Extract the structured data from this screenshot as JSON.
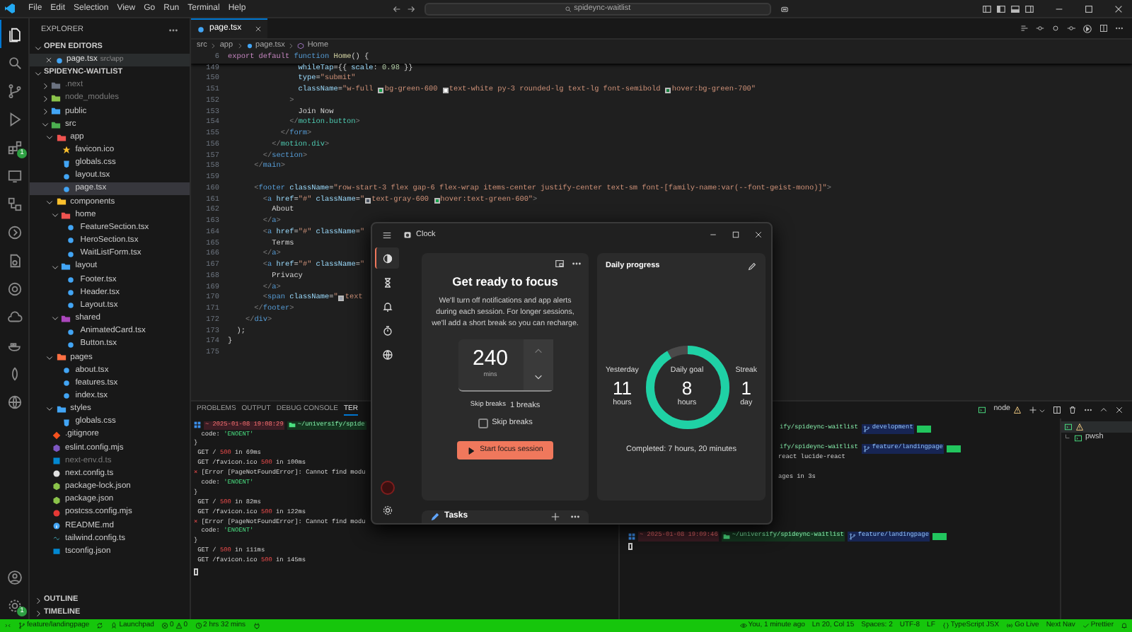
{
  "title_bar": {
    "menu": [
      "File",
      "Edit",
      "Selection",
      "View",
      "Go",
      "Run",
      "Terminal",
      "Help"
    ],
    "search": "spideync-waitlist"
  },
  "activity_bar": {
    "items": [
      {
        "kind": "files",
        "selected": true
      },
      {
        "kind": "search",
        "selected": false
      },
      {
        "kind": "branch",
        "selected": false
      },
      {
        "kind": "run",
        "selected": false
      },
      {
        "kind": "extensions",
        "selected": false,
        "badge": "1"
      },
      {
        "kind": "remote",
        "selected": false
      },
      {
        "kind": "nodes",
        "selected": false
      },
      {
        "kind": "circle",
        "selected": false
      },
      {
        "kind": "doc",
        "selected": false
      },
      {
        "kind": "ring",
        "selected": false
      },
      {
        "kind": "cloud",
        "selected": false
      },
      {
        "kind": "container",
        "selected": false
      },
      {
        "kind": "leaf",
        "selected": false
      },
      {
        "kind": "globe",
        "selected": false
      }
    ],
    "bottom": [
      {
        "kind": "account"
      },
      {
        "kind": "settings",
        "badge": "1"
      }
    ]
  },
  "sidebar": {
    "title": "EXPLORER",
    "open_editors": {
      "label": "OPEN EDITORS",
      "expanded": true,
      "items": [
        {
          "name": "page.tsx",
          "path": "src\\app",
          "kind": "react"
        }
      ]
    },
    "project": {
      "label": "SPIDEYNC-WAITLIST",
      "expanded": true,
      "tree": [
        {
          "label": ".next",
          "kind": "folder",
          "color": "#6b7280",
          "expanded": false,
          "selected": false,
          "dimmed": true
        },
        {
          "label": "node_modules",
          "kind": "folder",
          "color": "#8bc34a",
          "expanded": false,
          "selected": false,
          "dimmed": true
        },
        {
          "label": "public",
          "kind": "folder",
          "color": "#42a5f5",
          "expanded": false,
          "selected": false,
          "dimmed": false
        },
        {
          "label": "src",
          "kind": "folder",
          "color": "#4caf50",
          "expanded": true,
          "selected": false,
          "dimmed": false,
          "children": [
            {
              "label": "app",
              "kind": "folder",
              "color": "#ef5350",
              "expanded": true,
              "selected": false,
              "dimmed": false,
              "children": [
                {
                  "label": "favicon.ico",
                  "kind": "star",
                  "selected": false,
                  "dimmed": false
                },
                {
                  "label": "globals.css",
                  "kind": "css",
                  "selected": false,
                  "dimmed": false
                },
                {
                  "label": "layout.tsx",
                  "kind": "react",
                  "selected": false,
                  "dimmed": false
                },
                {
                  "label": "page.tsx",
                  "kind": "react",
                  "selected": true,
                  "dimmed": false
                }
              ]
            },
            {
              "label": "components",
              "kind": "folder",
              "color": "#fbc02d",
              "expanded": true,
              "selected": false,
              "dimmed": false,
              "children": [
                {
                  "label": "home",
                  "kind": "folder",
                  "color": "#ef5350",
                  "expanded": true,
                  "selected": false,
                  "dimmed": false,
                  "children": [
                    {
                      "label": "FeatureSection.tsx",
                      "kind": "react",
                      "selected": false,
                      "dimmed": false
                    },
                    {
                      "label": "HeroSection.tsx",
                      "kind": "react",
                      "selected": false,
                      "dimmed": false
                    },
                    {
                      "label": "WaitListForm.tsx",
                      "kind": "react",
                      "selected": false,
                      "dimmed": false
                    }
                  ]
                },
                {
                  "label": "layout",
                  "kind": "folder",
                  "color": "#42a5f5",
                  "expanded": true,
                  "selected": false,
                  "dimmed": false,
                  "children": [
                    {
                      "label": "Footer.tsx",
                      "kind": "react",
                      "selected": false,
                      "dimmed": false
                    },
                    {
                      "label": "Header.tsx",
                      "kind": "react",
                      "selected": false,
                      "dimmed": false
                    },
                    {
                      "label": "Layout.tsx",
                      "kind": "react",
                      "selected": false,
                      "dimmed": false
                    }
                  ]
                },
                {
                  "label": "shared",
                  "kind": "folder",
                  "color": "#ab47bc",
                  "expanded": true,
                  "selected": false,
                  "dimmed": false,
                  "children": [
                    {
                      "label": "AnimatedCard.tsx",
                      "kind": "react",
                      "selected": false,
                      "dimmed": false
                    },
                    {
                      "label": "Button.tsx",
                      "kind": "react",
                      "selected": false,
                      "dimmed": false
                    }
                  ]
                }
              ]
            },
            {
              "label": "pages",
              "kind": "folder",
              "color": "#ff7043",
              "expanded": true,
              "selected": false,
              "dimmed": false,
              "children": [
                {
                  "label": "about.tsx",
                  "kind": "react",
                  "selected": false,
                  "dimmed": false
                },
                {
                  "label": "features.tsx",
                  "kind": "react",
                  "selected": false,
                  "dimmed": false
                },
                {
                  "label": "index.tsx",
                  "kind": "react",
                  "selected": false,
                  "dimmed": false
                }
              ]
            },
            {
              "label": "styles",
              "kind": "folder",
              "color": "#42a5f5",
              "expanded": true,
              "selected": false,
              "dimmed": false,
              "children": [
                {
                  "label": "globals.css",
                  "kind": "css",
                  "selected": false,
                  "dimmed": false
                }
              ]
            }
          ]
        },
        {
          "label": ".gitignore",
          "kind": "git",
          "selected": false,
          "dimmed": false
        },
        {
          "label": "eslint.config.mjs",
          "kind": "eslint",
          "selected": false,
          "dimmed": false
        },
        {
          "label": "next-env.d.ts",
          "kind": "ts",
          "selected": false,
          "dimmed": true
        },
        {
          "label": "next.config.ts",
          "kind": "next",
          "selected": false,
          "dimmed": false
        },
        {
          "label": "package-lock.json",
          "kind": "npm",
          "selected": false,
          "dimmed": false
        },
        {
          "label": "package.json",
          "kind": "npm",
          "selected": false,
          "dimmed": false
        },
        {
          "label": "postcss.config.mjs",
          "kind": "postcss",
          "selected": false,
          "dimmed": false
        },
        {
          "label": "README.md",
          "kind": "info",
          "selected": false,
          "dimmed": false
        },
        {
          "label": "tailwind.config.ts",
          "kind": "tailwind",
          "selected": false,
          "dimmed": false
        },
        {
          "label": "tsconfig.json",
          "kind": "tsconfig",
          "selected": false,
          "dimmed": false
        }
      ]
    },
    "outline": {
      "label": "OUTLINE",
      "expanded": false
    },
    "timeline": {
      "label": "TIMELINE",
      "expanded": false
    }
  },
  "editor": {
    "tab": {
      "label": "page.tsx",
      "selected": true
    },
    "breadcrumb": [
      "src",
      "app",
      "page.tsx",
      "Home"
    ],
    "sticky_line": {
      "number": "6",
      "segments": [
        {
          "kind": "kw",
          "text": "export default "
        },
        {
          "kind": "decl",
          "text": "function "
        },
        {
          "kind": "fn",
          "text": "Home"
        },
        {
          "kind": "plain",
          "text": "() {"
        }
      ]
    },
    "lines": [
      {
        "number": "149",
        "segments": [
          {
            "kind": "attr",
            "text": "                whileTap"
          },
          {
            "kind": "plain",
            "text": "={{ "
          },
          {
            "kind": "attr",
            "text": "scale"
          },
          {
            "kind": "plain",
            "text": ": "
          },
          {
            "kind": "num",
            "text": "0.98"
          },
          {
            "kind": "plain",
            "text": " }}"
          }
        ]
      },
      {
        "number": "150",
        "segments": [
          {
            "kind": "attr",
            "text": "                type"
          },
          {
            "kind": "plain",
            "text": "="
          },
          {
            "kind": "str",
            "text": "\"submit\""
          }
        ]
      },
      {
        "number": "151",
        "segments": [
          {
            "kind": "attr",
            "text": "                className"
          },
          {
            "kind": "plain",
            "text": "="
          },
          {
            "kind": "str",
            "text": "\"w-full "
          },
          {
            "kind": "swatch",
            "color": "#16a34a"
          },
          {
            "kind": "str",
            "text": "bg-green-600 "
          },
          {
            "kind": "swatch",
            "color": "#ffffff"
          },
          {
            "kind": "str",
            "text": "text-white py-3 rounded-lg text-lg font-semibold "
          },
          {
            "kind": "swatch",
            "color": "#15803d"
          },
          {
            "kind": "str",
            "text": "hover:bg-green-700\""
          }
        ]
      },
      {
        "number": "152",
        "segments": [
          {
            "kind": "punct",
            "text": "              >"
          }
        ]
      },
      {
        "number": "153",
        "segments": [
          {
            "kind": "plain",
            "text": "                Join Now"
          }
        ]
      },
      {
        "number": "154",
        "segments": [
          {
            "kind": "punct",
            "text": "              </"
          },
          {
            "kind": "comp",
            "text": "motion.button"
          },
          {
            "kind": "punct",
            "text": ">"
          }
        ]
      },
      {
        "number": "155",
        "segments": [
          {
            "kind": "punct",
            "text": "            </"
          },
          {
            "kind": "tag",
            "text": "form"
          },
          {
            "kind": "punct",
            "text": ">"
          }
        ]
      },
      {
        "number": "156",
        "segments": [
          {
            "kind": "punct",
            "text": "          </"
          },
          {
            "kind": "comp",
            "text": "motion.div"
          },
          {
            "kind": "punct",
            "text": ">"
          }
        ]
      },
      {
        "number": "157",
        "segments": [
          {
            "kind": "punct",
            "text": "        </"
          },
          {
            "kind": "tag",
            "text": "section"
          },
          {
            "kind": "punct",
            "text": ">"
          }
        ]
      },
      {
        "number": "158",
        "segments": [
          {
            "kind": "punct",
            "text": "      </"
          },
          {
            "kind": "tag",
            "text": "main"
          },
          {
            "kind": "punct",
            "text": ">"
          }
        ]
      },
      {
        "number": "159"
      },
      {
        "number": "160",
        "segments": [
          {
            "kind": "punct",
            "text": "      <"
          },
          {
            "kind": "tag",
            "text": "footer "
          },
          {
            "kind": "attr",
            "text": "className"
          },
          {
            "kind": "plain",
            "text": "="
          },
          {
            "kind": "str",
            "text": "\"row-start-3 flex gap-6 flex-wrap items-center justify-center text-sm font-[family-name:var(--font-geist-mono)]\""
          },
          {
            "kind": "punct",
            "text": ">"
          }
        ]
      },
      {
        "number": "161",
        "segments": [
          {
            "kind": "punct",
            "text": "        <"
          },
          {
            "kind": "tag",
            "text": "a "
          },
          {
            "kind": "attr",
            "text": "href"
          },
          {
            "kind": "plain",
            "text": "="
          },
          {
            "kind": "str",
            "text": "\"#\" "
          },
          {
            "kind": "attr",
            "text": "className"
          },
          {
            "kind": "plain",
            "text": "="
          },
          {
            "kind": "str",
            "text": "\""
          },
          {
            "kind": "swatch",
            "color": "#4b5563"
          },
          {
            "kind": "str",
            "text": "text-gray-600 "
          },
          {
            "kind": "swatch",
            "color": "#16a34a"
          },
          {
            "kind": "str",
            "text": "hover:text-green-600\""
          },
          {
            "kind": "punct",
            "text": ">"
          }
        ]
      },
      {
        "number": "162",
        "segments": [
          {
            "kind": "plain",
            "text": "          About"
          }
        ]
      },
      {
        "number": "163",
        "segments": [
          {
            "kind": "punct",
            "text": "        </"
          },
          {
            "kind": "tag",
            "text": "a"
          },
          {
            "kind": "punct",
            "text": ">"
          }
        ]
      },
      {
        "number": "164",
        "segments": [
          {
            "kind": "punct",
            "text": "        <"
          },
          {
            "kind": "tag",
            "text": "a "
          },
          {
            "kind": "attr",
            "text": "href"
          },
          {
            "kind": "plain",
            "text": "="
          },
          {
            "kind": "str",
            "text": "\"#\" "
          },
          {
            "kind": "attr",
            "text": "className"
          },
          {
            "kind": "plain",
            "text": "="
          },
          {
            "kind": "str",
            "text": "\""
          }
        ]
      },
      {
        "number": "165",
        "segments": [
          {
            "kind": "plain",
            "text": "          Terms"
          }
        ]
      },
      {
        "number": "166",
        "segments": [
          {
            "kind": "punct",
            "text": "        </"
          },
          {
            "kind": "tag",
            "text": "a"
          },
          {
            "kind": "punct",
            "text": ">"
          }
        ]
      },
      {
        "number": "167",
        "segments": [
          {
            "kind": "punct",
            "text": "        <"
          },
          {
            "kind": "tag",
            "text": "a "
          },
          {
            "kind": "attr",
            "text": "href"
          },
          {
            "kind": "plain",
            "text": "="
          },
          {
            "kind": "str",
            "text": "\"#\" "
          },
          {
            "kind": "attr",
            "text": "className"
          },
          {
            "kind": "plain",
            "text": "="
          },
          {
            "kind": "str",
            "text": "\""
          }
        ]
      },
      {
        "number": "168",
        "segments": [
          {
            "kind": "plain",
            "text": "          Privacy"
          }
        ]
      },
      {
        "number": "169",
        "segments": [
          {
            "kind": "punct",
            "text": "        </"
          },
          {
            "kind": "tag",
            "text": "a"
          },
          {
            "kind": "punct",
            "text": ">"
          }
        ]
      },
      {
        "number": "170",
        "segments": [
          {
            "kind": "punct",
            "text": "        <"
          },
          {
            "kind": "tag",
            "text": "span "
          },
          {
            "kind": "attr",
            "text": "className"
          },
          {
            "kind": "plain",
            "text": "="
          },
          {
            "kind": "str",
            "text": "\""
          },
          {
            "kind": "swatch",
            "color": "#9ca3af"
          },
          {
            "kind": "str",
            "text": "text"
          }
        ]
      },
      {
        "number": "171",
        "segments": [
          {
            "kind": "punct",
            "text": "      </"
          },
          {
            "kind": "tag",
            "text": "footer"
          },
          {
            "kind": "punct",
            "text": ">"
          }
        ]
      },
      {
        "number": "172",
        "segments": [
          {
            "kind": "punct",
            "text": "    </"
          },
          {
            "kind": "tag",
            "text": "div"
          },
          {
            "kind": "punct",
            "text": ">"
          }
        ]
      },
      {
        "number": "173",
        "segments": [
          {
            "kind": "plain",
            "text": "  );"
          }
        ]
      },
      {
        "number": "174",
        "segments": [
          {
            "kind": "plain",
            "text": "}"
          }
        ]
      },
      {
        "number": "175"
      }
    ]
  },
  "panel": {
    "tabs": [
      {
        "label": "PROBLEMS",
        "selected": false
      },
      {
        "label": "OUTPUT",
        "selected": false
      },
      {
        "label": "DEBUG CONSOLE",
        "selected": false
      },
      {
        "label": "TER",
        "selected": true
      }
    ],
    "active_terminal": "node",
    "terminal_left": [
      {
        "kind": "prompt",
        "time": "~ 2025-01-08 19:08:29",
        "path": "~/universify/spide"
      },
      {
        "kind": "text",
        "segments": [
          {
            "kind": "plain",
            "text": "  code: "
          },
          {
            "kind": "green",
            "text": "'ENOENT'"
          }
        ]
      },
      {
        "kind": "text",
        "segments": [
          {
            "kind": "plain",
            "text": "}"
          }
        ]
      },
      {
        "kind": "text",
        "segments": [
          {
            "kind": "plain",
            "text": " GET / "
          },
          {
            "kind": "red",
            "text": "500"
          },
          {
            "kind": "plain",
            "text": " in 69ms"
          }
        ]
      },
      {
        "kind": "text",
        "segments": [
          {
            "kind": "plain",
            "text": " GET /favicon.ico "
          },
          {
            "kind": "red",
            "text": "500"
          },
          {
            "kind": "plain",
            "text": " in 100ms"
          }
        ]
      },
      {
        "kind": "text",
        "segments": [
          {
            "kind": "red",
            "text": "⨯"
          },
          {
            "kind": "plain",
            "text": " [Error [PageNotFoundError]: Cannot find modu"
          }
        ]
      },
      {
        "kind": "text",
        "segments": [
          {
            "kind": "plain",
            "text": "  code: "
          },
          {
            "kind": "green",
            "text": "'ENOENT'"
          }
        ]
      },
      {
        "kind": "text",
        "segments": [
          {
            "kind": "plain",
            "text": "}"
          }
        ]
      },
      {
        "kind": "text",
        "segments": [
          {
            "kind": "plain",
            "text": " GET / "
          },
          {
            "kind": "red",
            "text": "500"
          },
          {
            "kind": "plain",
            "text": " in 82ms"
          }
        ]
      },
      {
        "kind": "text",
        "segments": [
          {
            "kind": "plain",
            "text": " GET /favicon.ico "
          },
          {
            "kind": "red",
            "text": "500"
          },
          {
            "kind": "plain",
            "text": " in 122ms"
          }
        ]
      },
      {
        "kind": "text",
        "segments": [
          {
            "kind": "red",
            "text": "⨯"
          },
          {
            "kind": "plain",
            "text": " [Error [PageNotFoundError]: Cannot find modu"
          }
        ]
      },
      {
        "kind": "text",
        "segments": [
          {
            "kind": "plain",
            "text": "  code: "
          },
          {
            "kind": "green",
            "text": "'ENOENT'"
          }
        ]
      },
      {
        "kind": "text",
        "segments": [
          {
            "kind": "plain",
            "text": "}"
          }
        ]
      },
      {
        "kind": "text",
        "segments": [
          {
            "kind": "plain",
            "text": " GET / "
          },
          {
            "kind": "red",
            "text": "500"
          },
          {
            "kind": "plain",
            "text": " in 111ms"
          }
        ]
      },
      {
        "kind": "text",
        "segments": [
          {
            "kind": "plain",
            "text": " GET /favicon.ico "
          },
          {
            "kind": "red",
            "text": "500"
          },
          {
            "kind": "plain",
            "text": " in 145ms"
          }
        ]
      },
      {
        "kind": "cursor"
      }
    ],
    "terminal_right": [
      {
        "kind": "prompt_cut",
        "path": "ify/spideync-waitlist",
        "branch": "development"
      },
      {
        "kind": "blank"
      },
      {
        "kind": "prompt_cut",
        "path": "ify/spideync-waitlist",
        "branch": "feature/landingpage"
      },
      {
        "kind": "text_cut",
        "segments": [
          {
            "kind": "plain",
            "text": "react lucide-react"
          }
        ]
      },
      {
        "kind": "blank"
      },
      {
        "kind": "text_cut",
        "segments": [
          {
            "kind": "plain",
            "text": "ages in 3s"
          }
        ]
      },
      {
        "kind": "blank"
      },
      {
        "kind": "blank"
      },
      {
        "kind": "blank"
      },
      {
        "kind": "blank"
      },
      {
        "kind": "blank"
      },
      {
        "kind": "prompt",
        "time": "~ 2025-01-08 19:09:46",
        "path": "~/universify/spideync-waitlist",
        "branch": "feature/landingpage"
      },
      {
        "kind": "cursor"
      }
    ],
    "terminal_list": [
      {
        "kind": "warning",
        "selected": true
      },
      {
        "kind": "plain",
        "label": "pwsh",
        "selected": false
      }
    ]
  },
  "status_bar": {
    "left": [
      {
        "kind": "remote"
      },
      {
        "kind": "branch",
        "label": "feature/landingpage"
      },
      {
        "kind": "sync"
      },
      {
        "kind": "launchpad",
        "label": "Launchpad"
      },
      {
        "kind": "problems",
        "errors": "0",
        "warnings": "0"
      },
      {
        "kind": "timer",
        "label": "2 hrs 32 mins"
      },
      {
        "kind": "plug"
      }
    ],
    "right": [
      {
        "kind": "blame",
        "label": "You, 1 minute ago"
      },
      {
        "kind": "text",
        "label": "Ln 20, Col 15"
      },
      {
        "kind": "text",
        "label": "Spaces: 2"
      },
      {
        "kind": "text",
        "label": "UTF-8"
      },
      {
        "kind": "text",
        "label": "LF"
      },
      {
        "kind": "lang",
        "label": "TypeScript JSX"
      },
      {
        "kind": "golive",
        "label": "Go Live"
      },
      {
        "kind": "text",
        "label": "Next Nav"
      },
      {
        "kind": "prettier",
        "label": "Prettier"
      },
      {
        "kind": "bell"
      }
    ]
  },
  "clock": {
    "title": "Clock",
    "nav": [
      {
        "kind": "focus",
        "selected": true
      },
      {
        "kind": "timer",
        "selected": false
      },
      {
        "kind": "alarm",
        "selected": false
      },
      {
        "kind": "stopwatch",
        "selected": false
      },
      {
        "kind": "world",
        "selected": false
      }
    ],
    "focus": {
      "title": "Get ready to focus",
      "description": "We'll turn off notifications and app alerts during each session. For longer sessions, we'll add a short break so you can recharge.",
      "duration": "240",
      "unit": "mins",
      "breaks_label": "Skip breaks",
      "breaks_value": "1 breaks",
      "skip_breaks": {
        "label": "Skip breaks",
        "checked": false
      },
      "start_button": "Start focus session"
    },
    "daily": {
      "title": "Daily progress",
      "yesterday": {
        "label": "Yesterday",
        "value": "11",
        "unit": "hours"
      },
      "goal": {
        "label": "Daily goal",
        "value": "8",
        "unit": "hours",
        "level": 0.917
      },
      "streak": {
        "label": "Streak",
        "value": "1",
        "unit": "day"
      },
      "completed": "Completed: 7 hours, 20 minutes"
    },
    "tasks": {
      "title": "Tasks"
    }
  }
}
